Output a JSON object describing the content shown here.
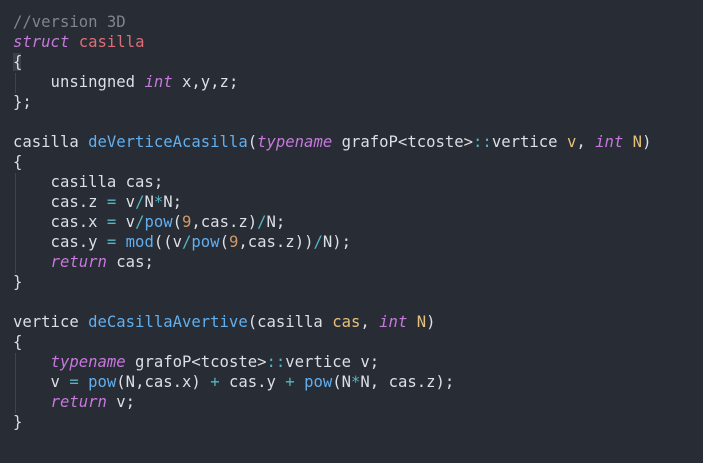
{
  "colors": {
    "background": "#282c34",
    "default": "#dcdfe4",
    "comment": "#7f848e",
    "keyword": "#c678dd",
    "type": "#c678dd",
    "function": "#61afef",
    "param": "#e5c07b",
    "number": "#d19a66",
    "operator": "#56b6c2",
    "struct_name": "#e06c75"
  },
  "lines": [
    [
      {
        "t": "//version 3D",
        "c": "comment"
      }
    ],
    [
      {
        "t": "struct",
        "c": "keyword"
      },
      {
        "t": " "
      },
      {
        "t": "casilla",
        "c": "struct_name"
      }
    ],
    [
      {
        "t": "{"
      }
    ],
    [
      {
        "t": "    unsingned "
      },
      {
        "t": "int",
        "c": "type"
      },
      {
        "t": " x,y,z;"
      }
    ],
    [
      {
        "t": "};"
      }
    ],
    [
      {
        "t": ""
      }
    ],
    [
      {
        "t": "casilla "
      },
      {
        "t": "deVerticeAcasilla",
        "c": "function"
      },
      {
        "t": "("
      },
      {
        "t": "typename",
        "c": "keyword"
      },
      {
        "t": " grafoP<tcoste>"
      },
      {
        "t": "::",
        "c": "operator"
      },
      {
        "t": "vertice "
      },
      {
        "t": "v",
        "c": "param"
      },
      {
        "t": ", "
      },
      {
        "t": "int",
        "c": "type"
      },
      {
        "t": " "
      },
      {
        "t": "N",
        "c": "param"
      },
      {
        "t": ")"
      }
    ],
    [
      {
        "t": "{"
      }
    ],
    [
      {
        "t": "    casilla cas;"
      }
    ],
    [
      {
        "t": "    cas.z "
      },
      {
        "t": "=",
        "c": "operator"
      },
      {
        "t": " v"
      },
      {
        "t": "/",
        "c": "operator"
      },
      {
        "t": "N"
      },
      {
        "t": "*",
        "c": "operator"
      },
      {
        "t": "N;"
      }
    ],
    [
      {
        "t": "    cas.x "
      },
      {
        "t": "=",
        "c": "operator"
      },
      {
        "t": " v"
      },
      {
        "t": "/",
        "c": "operator"
      },
      {
        "t": "pow",
        "c": "function"
      },
      {
        "t": "("
      },
      {
        "t": "9",
        "c": "number"
      },
      {
        "t": ",cas.z)"
      },
      {
        "t": "/",
        "c": "operator"
      },
      {
        "t": "N;"
      }
    ],
    [
      {
        "t": "    cas.y "
      },
      {
        "t": "=",
        "c": "operator"
      },
      {
        "t": " "
      },
      {
        "t": "mod",
        "c": "function"
      },
      {
        "t": "((v"
      },
      {
        "t": "/",
        "c": "operator"
      },
      {
        "t": "pow",
        "c": "function"
      },
      {
        "t": "("
      },
      {
        "t": "9",
        "c": "number"
      },
      {
        "t": ",cas.z))"
      },
      {
        "t": "/",
        "c": "operator"
      },
      {
        "t": "N);"
      }
    ],
    [
      {
        "t": "    "
      },
      {
        "t": "return",
        "c": "keyword"
      },
      {
        "t": " cas;"
      }
    ],
    [
      {
        "t": "}"
      }
    ],
    [
      {
        "t": ""
      }
    ],
    [
      {
        "t": "vertice "
      },
      {
        "t": "deCasillaAvertive",
        "c": "function"
      },
      {
        "t": "(casilla "
      },
      {
        "t": "cas",
        "c": "param"
      },
      {
        "t": ", "
      },
      {
        "t": "int",
        "c": "type"
      },
      {
        "t": " "
      },
      {
        "t": "N",
        "c": "param"
      },
      {
        "t": ")"
      }
    ],
    [
      {
        "t": "{"
      }
    ],
    [
      {
        "t": "    "
      },
      {
        "t": "typename",
        "c": "keyword"
      },
      {
        "t": " grafoP<tcoste>"
      },
      {
        "t": "::",
        "c": "operator"
      },
      {
        "t": "vertice v;"
      }
    ],
    [
      {
        "t": "    v "
      },
      {
        "t": "=",
        "c": "operator"
      },
      {
        "t": " "
      },
      {
        "t": "pow",
        "c": "function"
      },
      {
        "t": "(N,cas.x) "
      },
      {
        "t": "+",
        "c": "operator"
      },
      {
        "t": " cas.y "
      },
      {
        "t": "+",
        "c": "operator"
      },
      {
        "t": " "
      },
      {
        "t": "pow",
        "c": "function"
      },
      {
        "t": "(N"
      },
      {
        "t": "*",
        "c": "operator"
      },
      {
        "t": "N, cas.z);"
      }
    ],
    [
      {
        "t": "    "
      },
      {
        "t": "return",
        "c": "keyword"
      },
      {
        "t": " v;"
      }
    ],
    [
      {
        "t": "}"
      }
    ]
  ]
}
